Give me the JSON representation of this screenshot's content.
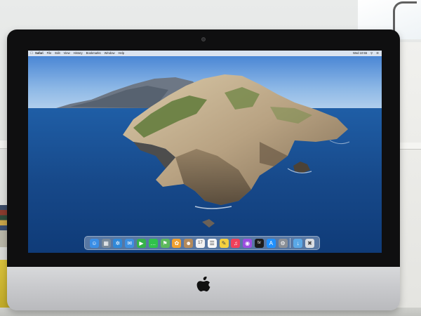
{
  "menubar": {
    "apple_icon": "apple-icon",
    "items": [
      "Safari",
      "File",
      "Edit",
      "View",
      "History",
      "Bookmarks",
      "Window",
      "Help"
    ],
    "status_text": "Wed 10:55"
  },
  "dock": {
    "apps": [
      {
        "name": "finder-icon",
        "color": "#3a8ee6"
      },
      {
        "name": "launchpad-icon",
        "color": "#7a8a9a"
      },
      {
        "name": "safari-icon",
        "color": "#2f88d8"
      },
      {
        "name": "mail-icon",
        "color": "#3d8fe0"
      },
      {
        "name": "facetime-icon",
        "color": "#35b24a"
      },
      {
        "name": "messages-icon",
        "color": "#30c24b"
      },
      {
        "name": "maps-icon",
        "color": "#5cb85c"
      },
      {
        "name": "photos-icon",
        "color": "#f0a030"
      },
      {
        "name": "contacts-icon",
        "color": "#b48a5a"
      },
      {
        "name": "calendar-icon",
        "color": "#f2f2f2"
      },
      {
        "name": "reminders-icon",
        "color": "#f7f7f7"
      },
      {
        "name": "notes-icon",
        "color": "#f4d03f"
      },
      {
        "name": "music-icon",
        "color": "#f0405a"
      },
      {
        "name": "podcasts-icon",
        "color": "#9b4de0"
      },
      {
        "name": "tv-icon",
        "color": "#1c1c1c"
      },
      {
        "name": "app-store-icon",
        "color": "#1e90ff"
      },
      {
        "name": "system-preferences-icon",
        "color": "#8a8f96"
      },
      {
        "name": "downloads-folder-icon",
        "color": "#5aa8e6"
      },
      {
        "name": "trash-icon",
        "color": "#d9dde2"
      }
    ]
  },
  "device": {
    "logo": "apple-logo-icon"
  }
}
